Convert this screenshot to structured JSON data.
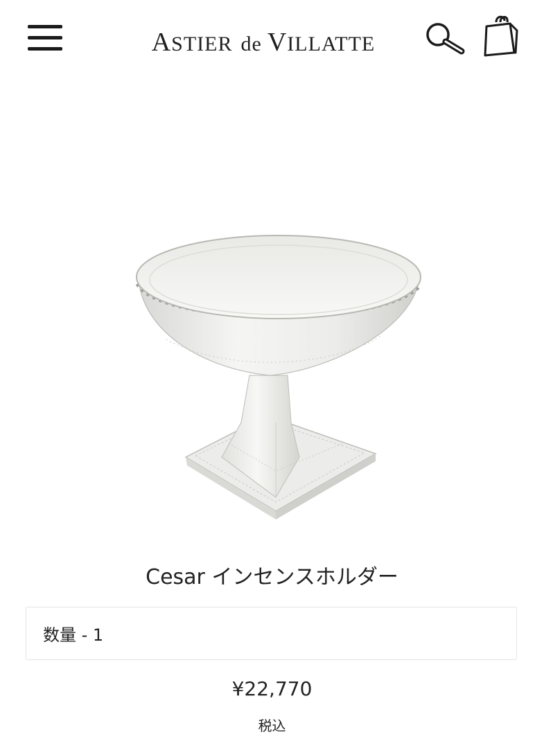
{
  "header": {
    "menu_icon": "hamburger-menu-icon",
    "logo": {
      "part1_cap": "A",
      "part1_rest": "STIER",
      "part2": "de",
      "part3_cap": "V",
      "part3_rest": "ILLATTE"
    },
    "search_icon": "search-icon",
    "bag_icon": "shopping-bag-icon"
  },
  "product": {
    "image_icon": "incense-holder-photo",
    "title": "Cesar インセンスホルダー",
    "quantity_label": "数量 - 1",
    "price": "¥22,770",
    "tax_note": "税込"
  }
}
